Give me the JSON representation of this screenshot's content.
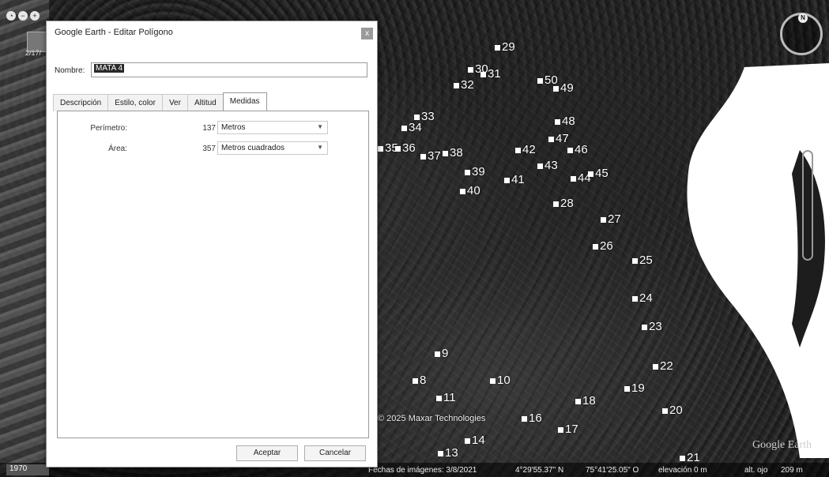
{
  "dialog": {
    "title": "Google Earth - Editar Polígono",
    "close_label": "x",
    "name_label": "Nombre:",
    "name_value": "MATA 4",
    "tabs": [
      {
        "label": "Descripción"
      },
      {
        "label": "Estilo, color"
      },
      {
        "label": "Ver"
      },
      {
        "label": "Altitud"
      },
      {
        "label": "Medidas"
      }
    ],
    "active_tab": "Medidas",
    "perimeter": {
      "label": "Perímetro:",
      "value": "137",
      "unit": "Metros"
    },
    "area": {
      "label": "Área:",
      "value": "357",
      "unit": "Metros cuadrados"
    },
    "accept_label": "Aceptar",
    "cancel_label": "Cancelar"
  },
  "map": {
    "thumbnail_date": "2/17/",
    "compass_label": "N",
    "copyright": "© 2025 Maxar Technologies",
    "logo_text": "Google Earth",
    "placemarks": [
      "29",
      "30",
      "31",
      "32",
      "50",
      "49",
      "33",
      "34",
      "35",
      "36",
      "37",
      "38",
      "48",
      "47",
      "46",
      "42",
      "43",
      "39",
      "40",
      "41",
      "44",
      "45",
      "28",
      "27",
      "26",
      "25",
      "24",
      "23",
      "22",
      "9",
      "8",
      "10",
      "11",
      "19",
      "18",
      "20",
      "16",
      "17",
      "14",
      "13",
      "21"
    ]
  },
  "statusbar": {
    "left_label": "1970",
    "imagery_date": "Fechas de imágenes: 3/8/2021",
    "lat": "4°29'55.37\" N",
    "lon": "75°41'25.05\" O",
    "elevation": "elevación   0 m",
    "eye_alt": "alt. ojo",
    "eye_alt_value": "209 m"
  }
}
